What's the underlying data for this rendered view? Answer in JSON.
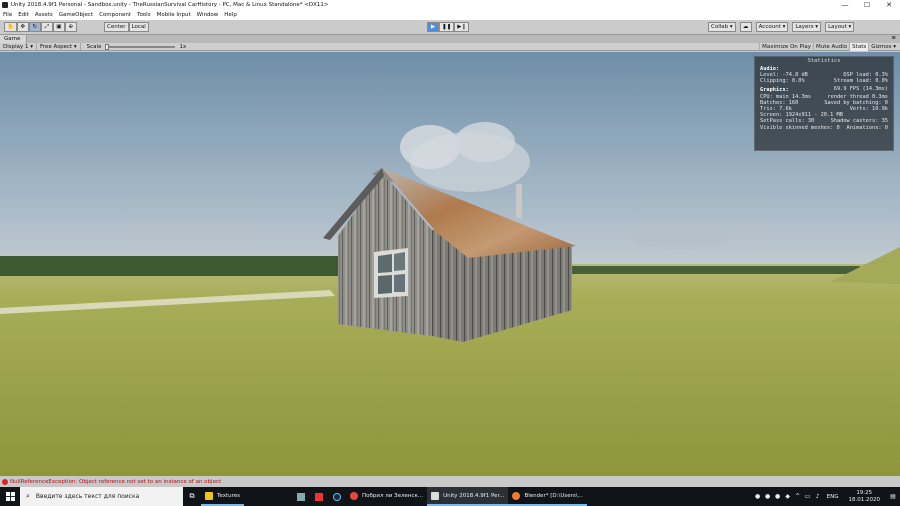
{
  "window": {
    "title": "Unity 2018.4.9f1 Personal - Sandbox.unity - TheRussianSurvival CarHistory - PC, Mac & Linux Standalone* <DX11>",
    "minimize": "—",
    "maximize": "☐",
    "close": "✕"
  },
  "menu": [
    "File",
    "Edit",
    "Assets",
    "GameObject",
    "Component",
    "Tools",
    "Mobile Input",
    "Window",
    "Help"
  ],
  "toolbar": {
    "pivot_label": "Center",
    "space_label": "Local",
    "collab_label": "Collab ▾",
    "account_label": "Account ▾",
    "layers_label": "Layers ▾",
    "layout_label": "Layout ▾"
  },
  "game_tab": {
    "label": "Game",
    "display": "Display 1 ▾",
    "aspect": "Free Aspect ▾",
    "scale_label": "Scale",
    "scale_value": "1x",
    "maximize_on_play": "Maximize On Play",
    "mute_audio": "Mute Audio",
    "stats": "Stats",
    "gizmos": "Gizmos ▾"
  },
  "stats_panel": {
    "title": "Statistics",
    "audio_header": "Audio:",
    "level": "Level: -74.8 dB",
    "dsp_load": "DSP load: 0.3%",
    "clipping": "Clipping: 0.0%",
    "stream_load": "Stream load: 0.0%",
    "graphics_header": "Graphics:",
    "fps": "69.9 FPS (14.3ms)",
    "cpu": "CPU: main 14.3ms",
    "render_thread": "render thread 0.3ms",
    "batches": "Batches: 160",
    "saved_batching": "Saved by batching: 0",
    "tris": "Tris: 7.6k",
    "verts": "Verts: 10.9k",
    "screen": "Screen: 1924x911 - 20.1 MB",
    "setpass": "SetPass calls: 30",
    "shadow_casters": "Shadow casters: 35",
    "skinned": "Visible skinned meshes: 0",
    "animations": "Animations: 0"
  },
  "status": {
    "error": "NullReferenceException: Object reference not set to an instance of an object"
  },
  "taskbar": {
    "search_placeholder": "Введите здесь текст для поиска",
    "apps": [
      {
        "label": "Textures"
      },
      {
        "label": "Побрил ли Зеленск..."
      },
      {
        "label": "Unity 2018.4.9f1 Per..."
      },
      {
        "label": "Blender* [D:\\Users\\..."
      }
    ],
    "lang": "ENG",
    "time": "19:25",
    "date": "18.01.2020"
  },
  "colors": {
    "accent": "#4b8fd8",
    "error": "#b31212",
    "taskbar": "#101418"
  }
}
